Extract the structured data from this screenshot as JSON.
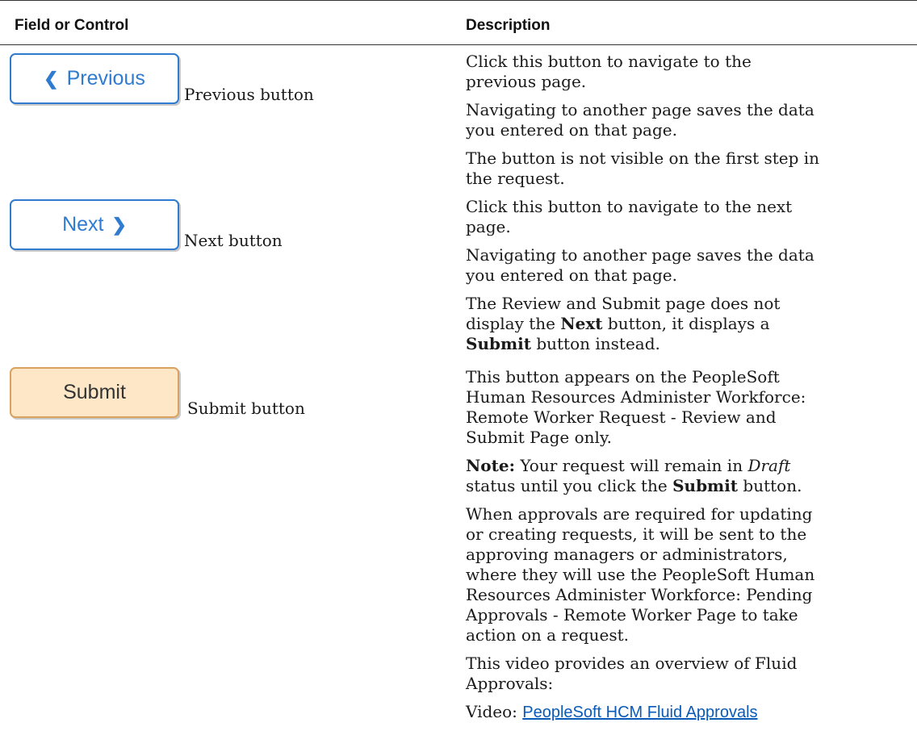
{
  "table": {
    "headers": {
      "field": "Field or Control",
      "description": "Description"
    }
  },
  "rows": {
    "previous": {
      "button_label": "Previous",
      "field_label": "Previous button",
      "desc": [
        "Click this button to navigate to the previous page.",
        "Navigating to another page saves the data you entered on that page.",
        "The button is not visible on the first step in the request."
      ]
    },
    "next": {
      "button_label": "Next",
      "field_label": "Next button",
      "desc": [
        "Click this button to navigate to the next page.",
        "Navigating to another page saves the data you entered on that page."
      ],
      "desc3": {
        "part1": "The Review and Submit page does not display the ",
        "bold1": "Next",
        "part2": " button, it displays a ",
        "bold2": "Submit",
        "part3": " button instead."
      }
    },
    "submit": {
      "button_label": "Submit",
      "field_label": "Submit button",
      "desc1": "This button appears on the PeopleSoft Human Resources Administer Workforce: Remote Worker Request - Review and Submit Page only.",
      "note": {
        "label": "Note:",
        "part1": " Your request will remain in ",
        "italic": "Draft",
        "part2": " status until you click the ",
        "bold": "Submit",
        "part3": " button."
      },
      "desc3": "When approvals are required for updating or creating requests, it will be sent to the approving managers or administrators, where they will use the PeopleSoft Human Resources Administer Workforce: Pending Approvals - Remote Worker Page to take action on a request.",
      "desc4": "This video provides an overview of Fluid Approvals:",
      "video_prefix": "Video: ",
      "video_link": "PeopleSoft HCM Fluid Approvals"
    }
  },
  "colors": {
    "button_blue": "#2f7bd0",
    "submit_fill": "#fde7c6",
    "submit_border": "#d9a35f",
    "link": "#0a5ab8"
  },
  "icons": {
    "previous": "chevron-left-icon",
    "next": "chevron-right-icon"
  }
}
